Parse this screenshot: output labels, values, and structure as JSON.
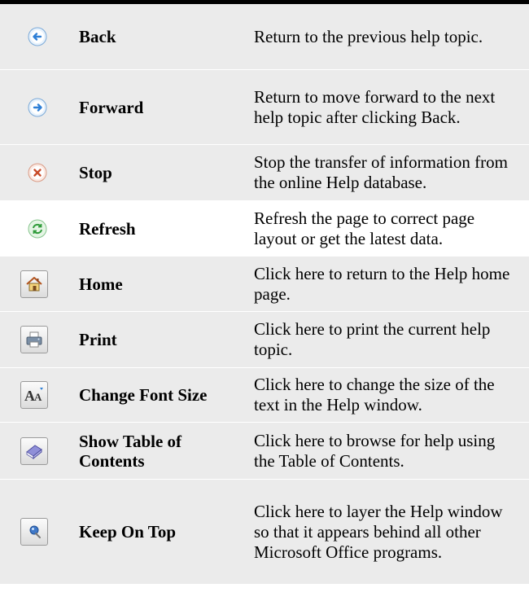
{
  "rows": [
    {
      "name": "Back",
      "description": "Return to the previous help topic.",
      "icon": "back-arrow-icon"
    },
    {
      "name": "Forward",
      "description": "Return to move forward to the next help topic after clicking Back.",
      "icon": "forward-arrow-icon"
    },
    {
      "name": "Stop",
      "description": "Stop the transfer of information from the online Help database.",
      "icon": "stop-icon"
    },
    {
      "name": "Refresh",
      "description": "Refresh the page to correct page layout or get the latest data.",
      "icon": "refresh-icon"
    },
    {
      "name": "Home",
      "description": "Click here to return to the Help home page.",
      "icon": "home-icon"
    },
    {
      "name": "Print",
      "description": "Click here to print the current help topic.",
      "icon": "print-icon"
    },
    {
      "name": "Change Font Size",
      "description": "Click here to change the size of the text in the Help window.",
      "icon": "font-size-icon"
    },
    {
      "name": "Show Table of Contents",
      "description": "Click here to browse for help using the Table of Contents.",
      "icon": "book-icon"
    },
    {
      "name": "Keep On Top",
      "description": "Click here to layer the Help window so that it appears behind all other Microsoft Office programs.",
      "icon": "pin-icon"
    }
  ],
  "colors": {
    "shade": "#ebebeb",
    "blue_accent": "#2e7fd6",
    "red_accent": "#c84a28",
    "green_accent": "#2f9b3a"
  }
}
